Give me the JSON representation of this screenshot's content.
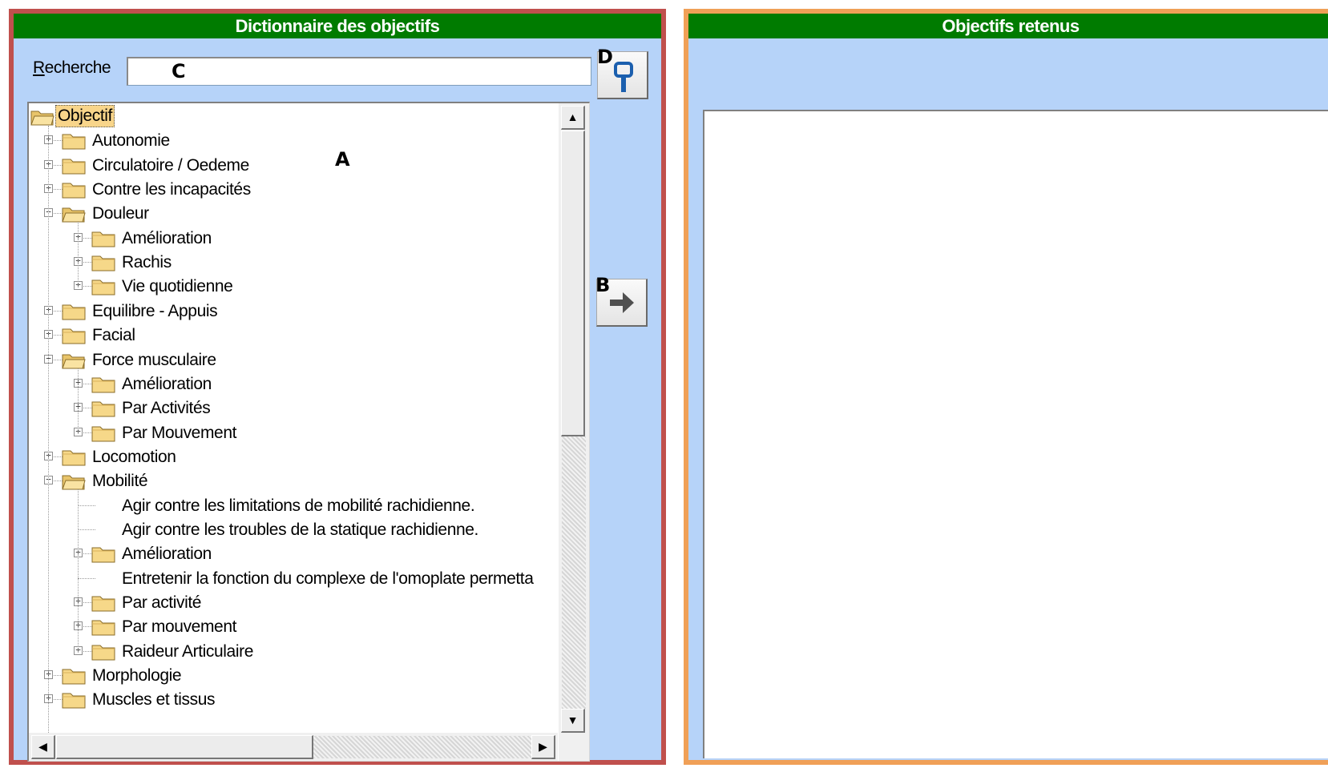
{
  "left_panel": {
    "title": "Dictionnaire des objectifs",
    "search_label_hotkey": "R",
    "search_label_rest": "echerche",
    "search_value": "",
    "annotations": {
      "tree": "A",
      "move_button": "B",
      "search_field": "C",
      "search_button": "D"
    }
  },
  "right_panel": {
    "title": "Objectifs retenus",
    "items": []
  },
  "tree": {
    "nodes": [
      {
        "label": "Objectif",
        "level": 0,
        "type": "folder",
        "state": "open",
        "selected": true
      },
      {
        "label": "Autonomie",
        "level": 1,
        "type": "folder",
        "state": "collapsed"
      },
      {
        "label": "Circulatoire / Oedeme",
        "level": 1,
        "type": "folder",
        "state": "collapsed"
      },
      {
        "label": "Contre les incapacités",
        "level": 1,
        "type": "folder",
        "state": "collapsed"
      },
      {
        "label": "Douleur",
        "level": 1,
        "type": "folder",
        "state": "expanded"
      },
      {
        "label": "Amélioration",
        "level": 2,
        "type": "folder",
        "state": "collapsed"
      },
      {
        "label": "Rachis",
        "level": 2,
        "type": "folder",
        "state": "collapsed"
      },
      {
        "label": "Vie quotidienne",
        "level": 2,
        "type": "folder",
        "state": "collapsed"
      },
      {
        "label": "Equilibre - Appuis",
        "level": 1,
        "type": "folder",
        "state": "collapsed"
      },
      {
        "label": "Facial",
        "level": 1,
        "type": "folder",
        "state": "collapsed"
      },
      {
        "label": "Force musculaire",
        "level": 1,
        "type": "folder",
        "state": "expanded"
      },
      {
        "label": "Amélioration",
        "level": 2,
        "type": "folder",
        "state": "collapsed"
      },
      {
        "label": "Par Activités",
        "level": 2,
        "type": "folder",
        "state": "collapsed"
      },
      {
        "label": "Par Mouvement",
        "level": 2,
        "type": "folder",
        "state": "collapsed"
      },
      {
        "label": "Locomotion",
        "level": 1,
        "type": "folder",
        "state": "collapsed"
      },
      {
        "label": "Mobilité",
        "level": 1,
        "type": "folder",
        "state": "expanded"
      },
      {
        "label": "Agir contre les limitations de mobilité rachidienne.",
        "level": 2,
        "type": "leaf"
      },
      {
        "label": "Agir contre les troubles de la statique rachidienne.",
        "level": 2,
        "type": "leaf"
      },
      {
        "label": "Amélioration",
        "level": 2,
        "type": "folder",
        "state": "collapsed"
      },
      {
        "label": "Entretenir la fonction du complexe de l'omoplate permetta",
        "level": 2,
        "type": "leaf"
      },
      {
        "label": "Par activité",
        "level": 2,
        "type": "folder",
        "state": "collapsed"
      },
      {
        "label": "Par mouvement",
        "level": 2,
        "type": "folder",
        "state": "collapsed"
      },
      {
        "label": "Raideur Articulaire",
        "level": 2,
        "type": "folder",
        "state": "collapsed"
      },
      {
        "label": "Morphologie",
        "level": 1,
        "type": "folder",
        "state": "collapsed"
      },
      {
        "label": "Muscles et tissus",
        "level": 1,
        "type": "folder",
        "state": "collapsed"
      }
    ]
  },
  "icons": {
    "search_button": "search-icon",
    "move_button": "arrow-right-icon",
    "scroll_up": "scroll-up-icon",
    "scroll_down": "scroll-down-icon",
    "scroll_left": "scroll-left-icon",
    "scroll_right": "scroll-right-icon"
  },
  "colors": {
    "header_green": "#007b00",
    "panel_blue": "#b6d3f9",
    "left_frame": "#c0504d",
    "right_frame": "#f0a057",
    "selection": "#f8d58a",
    "folder": "#f6d889"
  }
}
